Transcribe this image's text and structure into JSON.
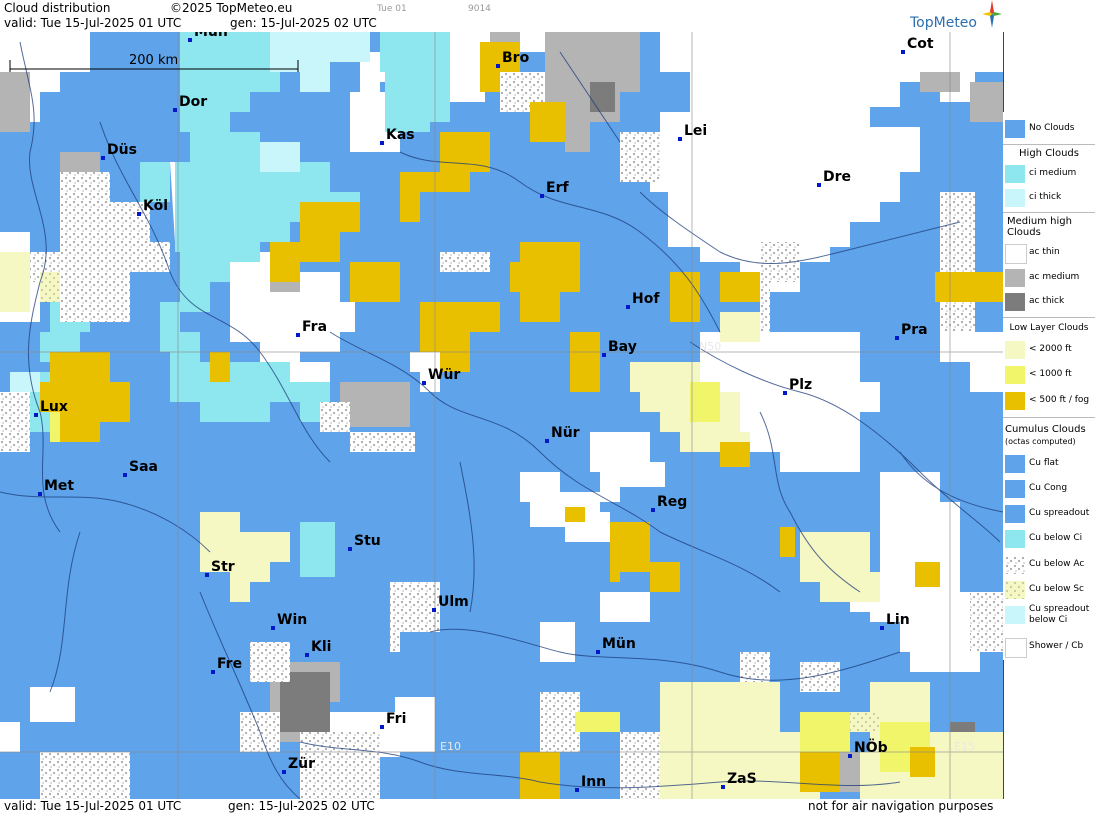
{
  "header": {
    "product": "Cloud distribution",
    "copyright": "©2025 TopMeteo.eu",
    "run_code": "Tue 01",
    "id_code": "9014",
    "valid": "valid:  Tue  15-Jul-2025  01 UTC",
    "generated": "gen: 15-Jul-2025 02 UTC",
    "logo": "TopMeteo"
  },
  "scale": {
    "label": "200 km"
  },
  "grid_labels": {
    "lat": "N50",
    "lon_e10": "E10",
    "lon_e15": "E15"
  },
  "cities": [
    {
      "name": "Mün",
      "label": "Mün"
    },
    {
      "name": "Dor",
      "label": "Dor"
    },
    {
      "name": "Bro",
      "label": "Bro"
    },
    {
      "name": "Cot",
      "label": "Cot"
    },
    {
      "name": "Lei",
      "label": "Lei"
    },
    {
      "name": "Kas",
      "label": "Kas"
    },
    {
      "name": "Düs",
      "label": "Düs"
    },
    {
      "name": "Erf",
      "label": "Erf"
    },
    {
      "name": "Dre",
      "label": "Dre"
    },
    {
      "name": "Köl",
      "label": "Köl"
    },
    {
      "name": "Hof",
      "label": "Hof"
    },
    {
      "name": "Fra",
      "label": "Fra"
    },
    {
      "name": "Pra",
      "label": "Pra"
    },
    {
      "name": "Bay",
      "label": "Bay"
    },
    {
      "name": "Wür",
      "label": "Wür"
    },
    {
      "name": "Plz",
      "label": "Plz"
    },
    {
      "name": "Lux",
      "label": "Lux"
    },
    {
      "name": "Nür",
      "label": "Nür"
    },
    {
      "name": "Saa",
      "label": "Saa"
    },
    {
      "name": "Met",
      "label": "Met"
    },
    {
      "name": "Reg",
      "label": "Reg"
    },
    {
      "name": "Stu",
      "label": "Stu"
    },
    {
      "name": "Str",
      "label": "Str"
    },
    {
      "name": "Ulm",
      "label": "Ulm"
    },
    {
      "name": "Win",
      "label": "Win"
    },
    {
      "name": "Lin",
      "label": "Lin"
    },
    {
      "name": "Kli",
      "label": "Kli"
    },
    {
      "name": "Mün2",
      "label": "Mün"
    },
    {
      "name": "Fre",
      "label": "Fre"
    },
    {
      "name": "Fri",
      "label": "Fri"
    },
    {
      "name": "NÖb",
      "label": "NÖb"
    },
    {
      "name": "Zür",
      "label": "Zür"
    },
    {
      "name": "Inn",
      "label": "Inn"
    },
    {
      "name": "ZaS",
      "label": "ZaS"
    }
  ],
  "legend": {
    "no_clouds": "No Clouds",
    "high_heading": "High Clouds",
    "ci_medium": "ci medium",
    "ci_thick": "ci thick",
    "medium_heading": "Medium high Clouds",
    "ac_thin": "ac thin",
    "ac_medium": "ac medium",
    "ac_thick": "ac thick",
    "low_heading": "Low Layer Clouds",
    "low_2000": "< 2000 ft",
    "low_1000": "< 1000 ft",
    "low_500": "< 500 ft / fog",
    "cumulus_heading": "Cumulus Clouds",
    "cumulus_sub": "(octas computed)",
    "cu_flat": "Cu flat",
    "cu_cong": "Cu Cong",
    "cu_spreadout": "Cu spreadout",
    "cu_below_ci": "Cu below Ci",
    "cu_below_ac": "Cu below Ac",
    "cu_below_sc": "Cu below Sc",
    "cu_spreadout_below_ci": "Cu spreadout below Ci",
    "shower": "Shower / Cb"
  },
  "colors": {
    "no_clouds": "#5fa3ea",
    "ci_medium": "#8ee6ef",
    "ci_thick": "#c8f6fa",
    "ac_thin": "#ffffff",
    "ac_medium": "#b4b4b4",
    "ac_thick": "#7c7c7c",
    "low_2000": "#f6f8c4",
    "low_1000": "#f0f56a",
    "low_500": "#e8c000"
  },
  "footer": {
    "valid": "valid:  Tue  15-Jul-2025  01 UTC",
    "generated": "gen: 15-Jul-2025 02 UTC",
    "disclaimer": "not for air navigation purposes"
  }
}
